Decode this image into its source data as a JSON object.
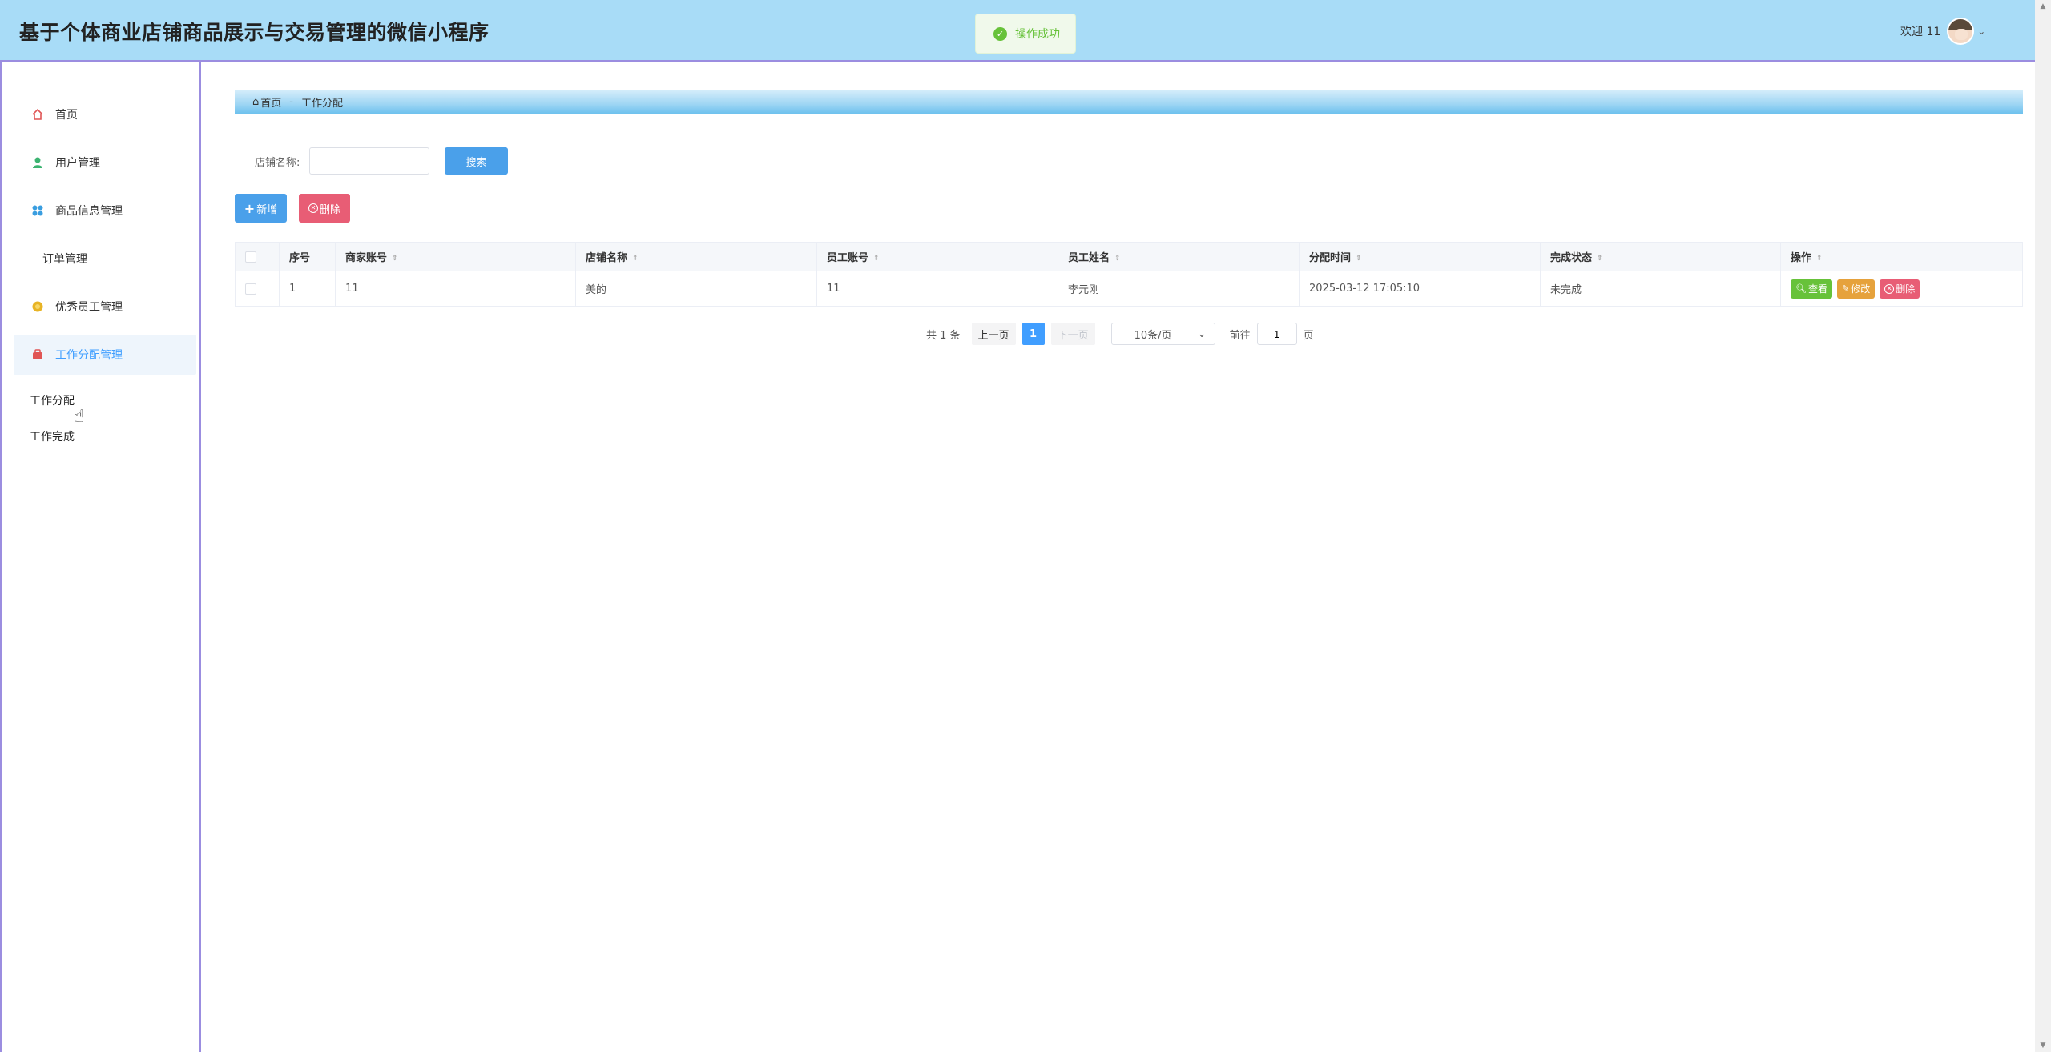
{
  "header": {
    "title": "基于个体商业店铺商品展示与交易管理的微信小程序",
    "toast_text": "操作成功",
    "welcome": "欢迎 11"
  },
  "sidebar": {
    "items": [
      {
        "label": "首页",
        "icon": "home-icon"
      },
      {
        "label": "用户管理",
        "icon": "user-icon"
      },
      {
        "label": "商品信息管理",
        "icon": "grid-icon"
      },
      {
        "label": "订单管理",
        "icon": ""
      },
      {
        "label": "优秀员工管理",
        "icon": "medal-icon"
      },
      {
        "label": "工作分配管理",
        "icon": "briefcase-icon"
      }
    ],
    "submenu": [
      "工作分配",
      "工作完成"
    ]
  },
  "breadcrumb": {
    "home": "首页",
    "separator": "-",
    "current": "工作分配"
  },
  "search": {
    "label": "店铺名称:",
    "value": "",
    "button": "搜索"
  },
  "actions": {
    "add": "新增",
    "delete": "删除"
  },
  "table": {
    "columns": [
      "序号",
      "商家账号",
      "店铺名称",
      "员工账号",
      "员工姓名",
      "分配时间",
      "完成状态",
      "操作"
    ],
    "rows": [
      {
        "index": "1",
        "merchant_account": "11",
        "shop_name": "美的",
        "employee_account": "11",
        "employee_name": "李元刚",
        "assign_time": "2025-03-12 17:05:10",
        "status": "未完成",
        "ops": {
          "view": "查看",
          "edit": "修改",
          "delete": "删除"
        }
      }
    ]
  },
  "pagination": {
    "total": "共 1 条",
    "prev": "上一页",
    "current_page": "1",
    "next": "下一页",
    "page_size": "10条/页",
    "goto": "前往",
    "jump_value": "1",
    "page_unit": "页"
  },
  "colors": {
    "header_bg": "#a8dcf7",
    "accent_border": "#9b8de0",
    "primary": "#409eff",
    "success": "#67c23a",
    "warning": "#e6a23c",
    "danger": "#e85d75"
  }
}
